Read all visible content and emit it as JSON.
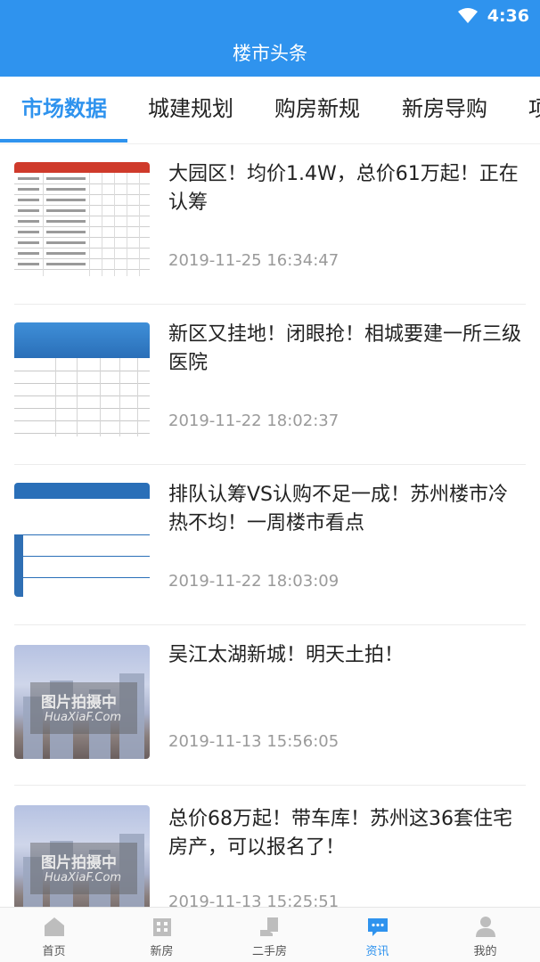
{
  "status_bar": {
    "time": "4:36",
    "wifi_icon": "wifi-icon",
    "battery_icon": "battery-icon"
  },
  "header": {
    "title": "楼市头条"
  },
  "tabs": [
    {
      "label": "市场数据",
      "active": true
    },
    {
      "label": "城建规划",
      "active": false
    },
    {
      "label": "购房新规",
      "active": false
    },
    {
      "label": "新房导购",
      "active": false
    },
    {
      "label": "项",
      "active": false
    }
  ],
  "articles": [
    {
      "headline": "大园区！均价1.4W，总价61万起！正在认筹",
      "date": "2019-11-25 16:34:47",
      "thumb": "table"
    },
    {
      "headline": "新区又挂地！闭眼抢！相城要建一所三级医院",
      "date": "2019-11-22 18:02:37",
      "thumb": "blue-table"
    },
    {
      "headline": "排队认筹VS认购不足一成！苏州楼市冷热不均！一周楼市看点",
      "date": "2019-11-22 18:03:09",
      "thumb": "ranking-table"
    },
    {
      "headline": "吴江太湖新城！明天土拍！",
      "date": "2019-11-13 15:56:05",
      "thumb": "photo",
      "watermark_1": "图片拍摄中",
      "watermark_2": "HuaXiaF.Com"
    },
    {
      "headline": "总价68万起！带车库！苏州这36套住宅房产，可以报名了！",
      "date": "2019-11-13 15:25:51",
      "thumb": "photo",
      "watermark_1": "图片拍摄中",
      "watermark_2": "HuaXiaF.Com"
    }
  ],
  "bottom_nav": [
    {
      "label": "首页",
      "icon": "home-icon",
      "active": false
    },
    {
      "label": "新房",
      "icon": "building-icon",
      "active": false
    },
    {
      "label": "二手房",
      "icon": "house-hand-icon",
      "active": false
    },
    {
      "label": "资讯",
      "icon": "chat-bubble-icon",
      "active": true
    },
    {
      "label": "我的",
      "icon": "user-icon",
      "active": false
    }
  ],
  "colors": {
    "brand": "#2f93ee",
    "text": "#222222",
    "muted": "#9a9a9a"
  }
}
